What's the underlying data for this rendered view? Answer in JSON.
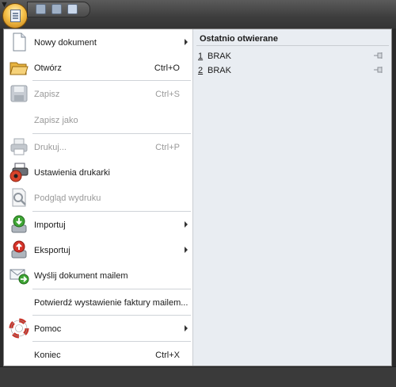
{
  "menu": {
    "items": [
      {
        "label": "Nowy dokument",
        "shortcut": "",
        "icon": "new-document-icon"
      },
      {
        "label": "Otwórz",
        "shortcut": "Ctrl+O",
        "icon": "open-folder-icon"
      },
      {
        "label": "Zapisz",
        "shortcut": "Ctrl+S",
        "icon": "save-disk-icon"
      },
      {
        "label": "Zapisz jako",
        "shortcut": ""
      },
      {
        "label": "Drukuj...",
        "shortcut": "Ctrl+P",
        "icon": "printer-icon"
      },
      {
        "label": "Ustawienia drukarki",
        "shortcut": "",
        "icon": "printer-settings-icon"
      },
      {
        "label": "Podgląd wydruku",
        "shortcut": "",
        "icon": "print-preview-icon"
      },
      {
        "label": "Importuj",
        "shortcut": "",
        "icon": "import-icon"
      },
      {
        "label": "Eksportuj",
        "shortcut": "",
        "icon": "export-icon"
      },
      {
        "label": "Wyślij dokument mailem",
        "shortcut": "",
        "icon": "mail-send-icon"
      },
      {
        "label": "Potwierdź wystawienie faktury mailem...",
        "shortcut": ""
      },
      {
        "label": "Pomoc",
        "shortcut": "",
        "icon": "lifebuoy-icon"
      },
      {
        "label": "Koniec",
        "shortcut": "Ctrl+X"
      }
    ]
  },
  "recent": {
    "title": "Ostatnio otwierane",
    "items": [
      {
        "num": "1",
        "name": "BRAK"
      },
      {
        "num": "2",
        "name": "BRAK"
      }
    ]
  },
  "colors": {
    "accent": "#f6c24a",
    "disabled_text": "#9a9a9a",
    "panel": "#e9edf2"
  }
}
